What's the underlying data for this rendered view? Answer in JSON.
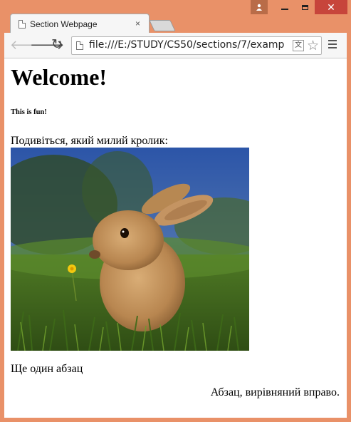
{
  "window": {
    "controls": {
      "user": "user-icon",
      "minimize": "minimize-icon",
      "maximize": "maximize-icon",
      "close": "close-icon"
    }
  },
  "tab": {
    "title": "Section Webpage",
    "close": "×"
  },
  "toolbar": {
    "url": "file:///E:/STUDY/CS50/sections/7/examp"
  },
  "page": {
    "heading": "Welcome!",
    "subheading": "This is fun!",
    "paragraph1": "Подивіться, який милий кролик:",
    "paragraph2": "Ще один абзац",
    "paragraph3": "Абзац, вирівняний вправо."
  },
  "colors": {
    "frame": "#e99168",
    "close": "#c7453b"
  }
}
